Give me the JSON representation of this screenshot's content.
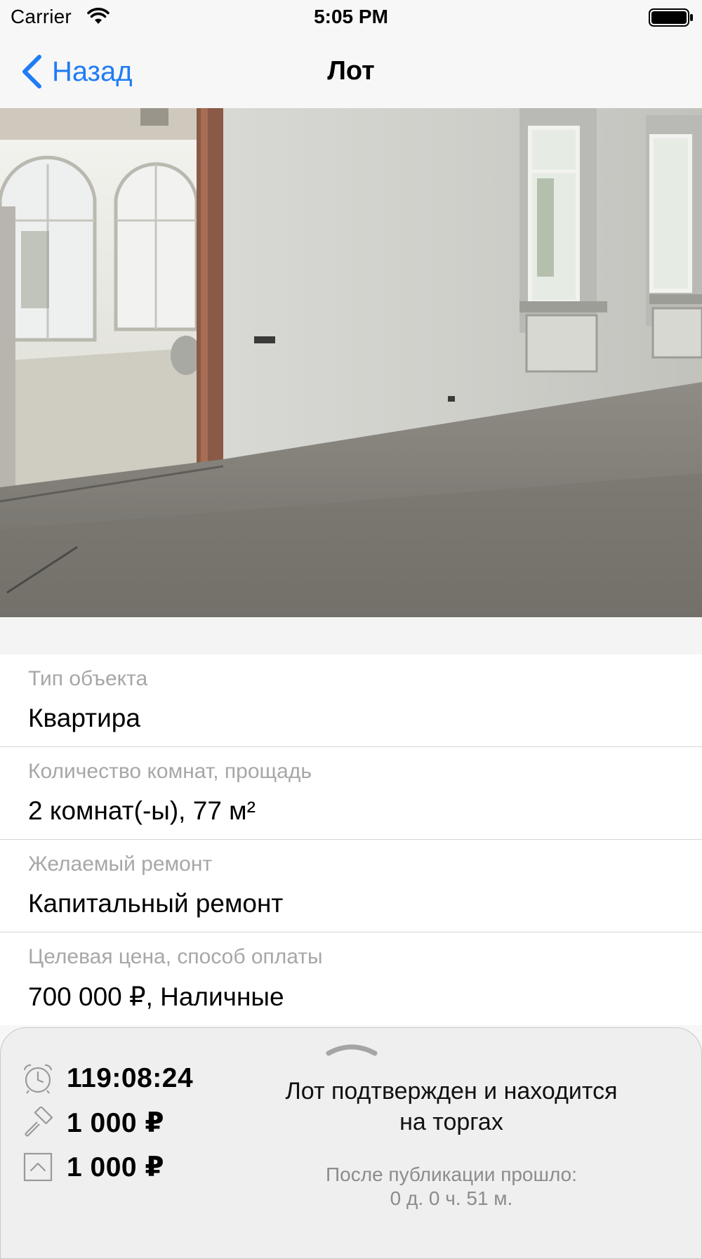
{
  "status_bar": {
    "carrier": "Carrier",
    "time": "5:05 PM"
  },
  "nav": {
    "back_label": "Назад",
    "title": "Лот"
  },
  "details": [
    {
      "label": "Тип объекта",
      "value": "Квартира"
    },
    {
      "label": "Количество комнат, прощадь",
      "value": "2 комнат(-ы), 77 м²"
    },
    {
      "label": "Желаемый ремонт",
      "value": "Капитальный ремонт"
    },
    {
      "label": "Целевая цена, способ оплаты",
      "value": "700 000 ₽, Наличные"
    }
  ],
  "bottom_panel": {
    "timer": "119:08:24",
    "current_bid": "1 000 ₽",
    "bid_step": "1 000 ₽",
    "status_text_line1": "Лот подтвержден и находится",
    "status_text_line2": "на торгах",
    "elapsed_label": "После публикации прошло:",
    "elapsed_value": "0 д. 0 ч. 51 м."
  },
  "icons": {
    "timer": "alarm-clock-icon",
    "bid": "gavel-icon",
    "step": "arrow-up-square-icon",
    "back": "chevron-left-icon",
    "handle": "drag-handle-icon"
  },
  "colors": {
    "accent": "#1f7cf5",
    "label_gray": "#a7a7a7",
    "panel_bg": "#efefef"
  }
}
